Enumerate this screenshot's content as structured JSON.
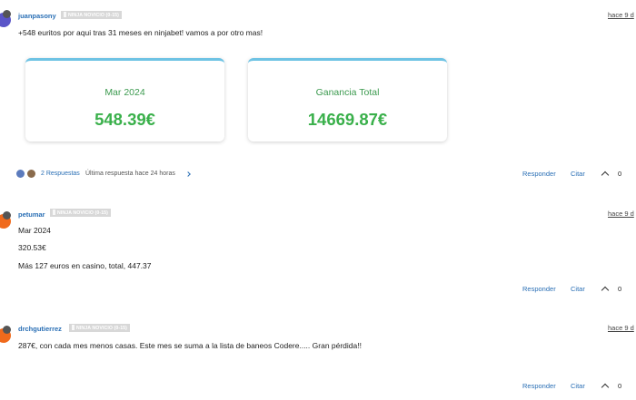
{
  "colors": {
    "link": "#2a6fb5",
    "green": "#3ab04b",
    "card_accent": "#6ec3e4",
    "rank_bg": "#d8d8d8"
  },
  "posts": [
    {
      "username": "juanpasony",
      "rank": "NINJA NOVICIO (0-15)",
      "time": "hace 9 d",
      "lines": [
        "+548 euritos por aqui tras 31 meses en ninjabet! vamos a por otro mas!"
      ],
      "cards": [
        {
          "label": "Mar 2024",
          "value": "548.39€"
        },
        {
          "label": "Ganancia Total",
          "value": "14669.87€"
        }
      ],
      "replies": {
        "count_label": "2 Respuestas",
        "last_reply": "Última respuesta hace 24 horas"
      },
      "actions": {
        "reply": "Responder",
        "quote": "Citar",
        "score": "0"
      }
    },
    {
      "username": "petumar",
      "rank": "NINJA NOVICIO (0-15)",
      "time": "hace 9 d",
      "lines": [
        "Mar 2024",
        "320.53€",
        "Más 127 euros en casino, total, 447.37"
      ],
      "actions": {
        "reply": "Responder",
        "quote": "Citar",
        "score": "0"
      }
    },
    {
      "username": "drchgutierrez",
      "rank": "NINJA NOVICIO (0-15)",
      "time": "hace 9 d",
      "lines": [
        "287€, con cada mes menos casas. Este mes se suma a la lista de baneos Codere..... Gran pérdida!!"
      ],
      "actions": {
        "reply": "Responder",
        "quote": "Citar",
        "score": "0"
      }
    }
  ]
}
